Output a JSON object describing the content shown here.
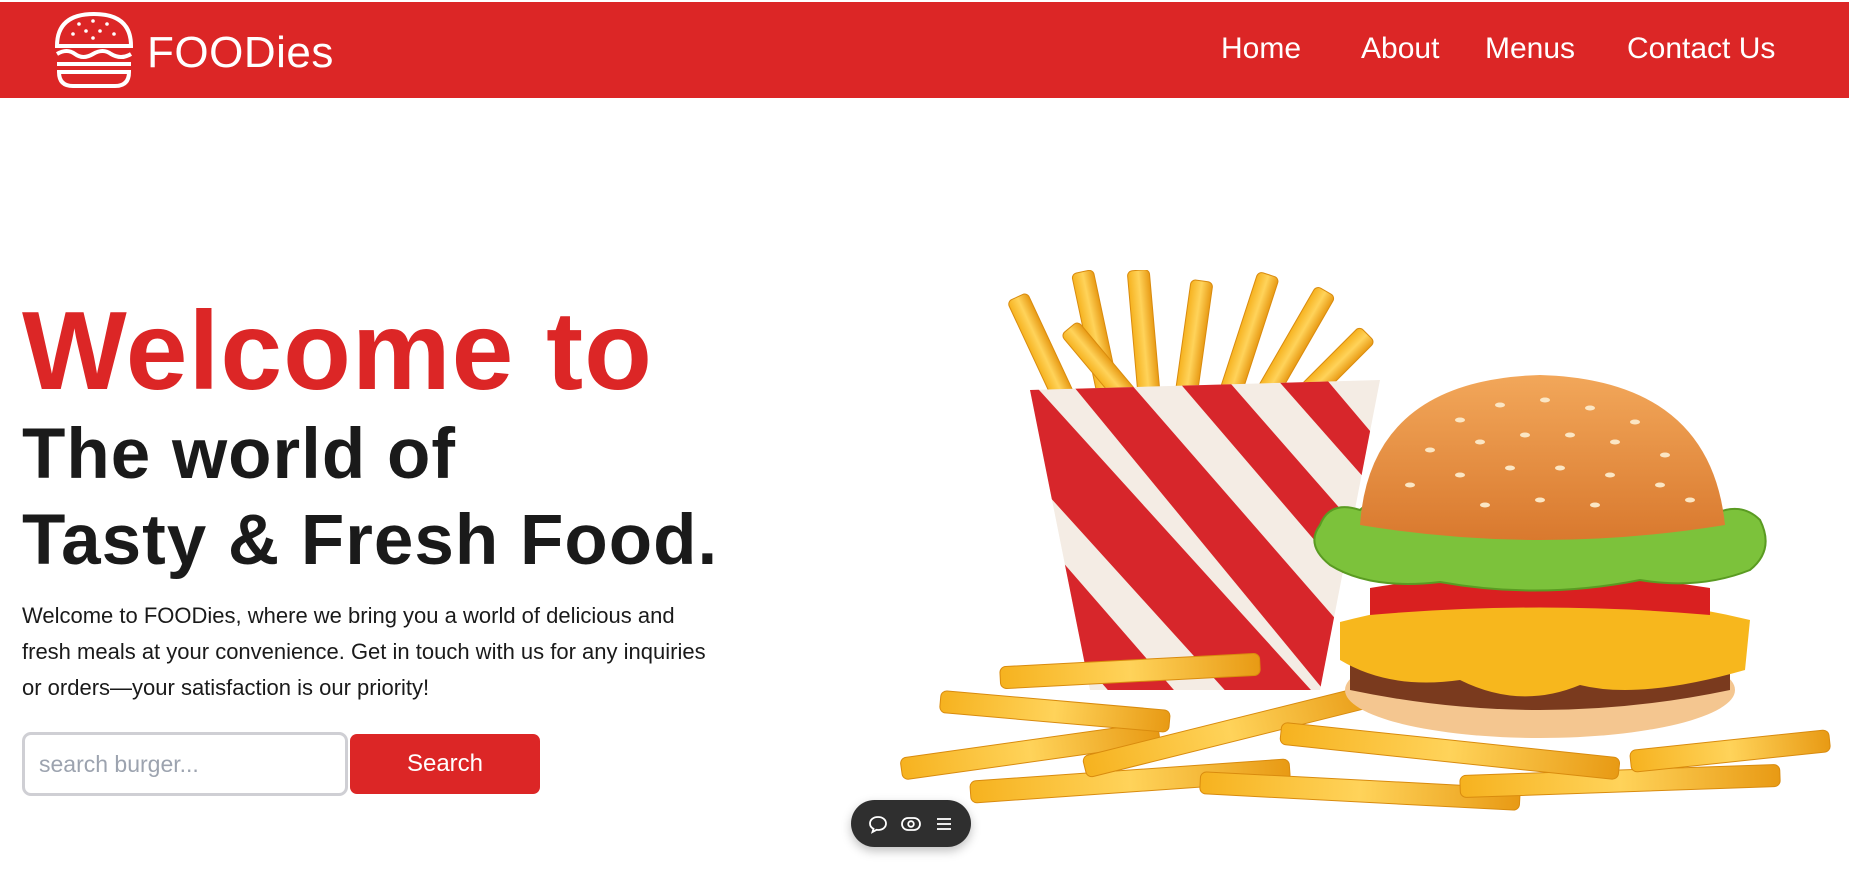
{
  "brand": {
    "name": "FOODies",
    "logo_icon": "burger-icon"
  },
  "nav": {
    "items": [
      {
        "label": "Home"
      },
      {
        "label": "About"
      },
      {
        "label": "Menus"
      },
      {
        "label": "Contact Us"
      }
    ]
  },
  "hero": {
    "title_line1": "Welcome to",
    "title_line2": "The world of",
    "title_line3": "Tasty & Fresh Food.",
    "description": "Welcome to FOODies, where we bring you a world of delicious and fresh meals at your convenience. Get in touch with us for any inquiries or orders—your satisfaction is our priority!",
    "search": {
      "placeholder": "search burger...",
      "value": "",
      "button_label": "Search"
    },
    "image_icon": "burger-and-fries-image"
  },
  "floating_toolbar": {
    "icons": [
      "comment-icon",
      "eye-icon",
      "menu-icon"
    ]
  },
  "colors": {
    "accent": "#dc2626",
    "text": "#1a1a1a",
    "background": "#ffffff"
  }
}
